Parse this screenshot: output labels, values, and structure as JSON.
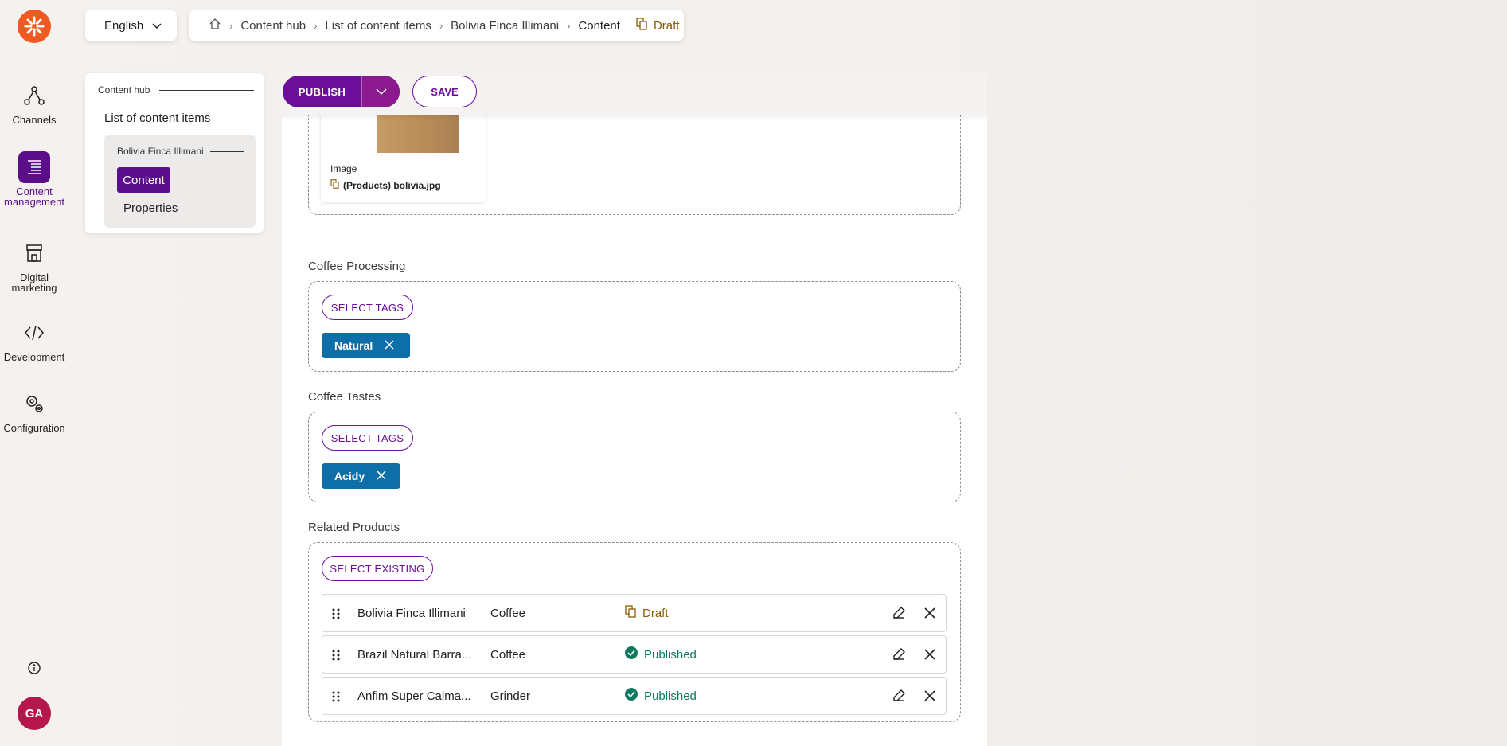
{
  "nav": {
    "items": [
      {
        "label": "Channels"
      },
      {
        "label": "Content\nmanagement"
      },
      {
        "label": "Digital\nmarketing"
      },
      {
        "label": "Development"
      },
      {
        "label": "Configuration"
      }
    ],
    "avatar": "GA"
  },
  "language": {
    "selected": "English"
  },
  "breadcrumb": {
    "items": [
      "Content hub",
      "List of content items",
      "Bolivia Finca Illimani",
      "Content"
    ],
    "status": "Draft"
  },
  "tree": {
    "hub": "Content hub",
    "list": "List of content items",
    "item": "Bolivia Finca Illimani",
    "content": "Content",
    "properties": "Properties"
  },
  "toolbar": {
    "publish": "PUBLISH",
    "save": "SAVE"
  },
  "image_field": {
    "label": "Image",
    "file": "(Products) bolivia.jpg"
  },
  "processing": {
    "label": "Coffee Processing",
    "button": "SELECT TAGS",
    "tag": "Natural"
  },
  "tastes": {
    "label": "Coffee Tastes",
    "button": "SELECT TAGS",
    "tag": "Acidy"
  },
  "related": {
    "label": "Related Products",
    "button": "SELECT EXISTING",
    "rows": [
      {
        "name": "Bolivia Finca Illimani",
        "type": "Coffee",
        "status": "Draft"
      },
      {
        "name": "Brazil Natural Barra...",
        "type": "Coffee",
        "status": "Published"
      },
      {
        "name": "Anfim Super Caima...",
        "type": "Grinder",
        "status": "Published"
      }
    ]
  },
  "colors": {
    "accent": "#5b0e8a",
    "tag": "#0e6fa8",
    "draft": "#8a5a00",
    "published": "#0d7a5f"
  }
}
